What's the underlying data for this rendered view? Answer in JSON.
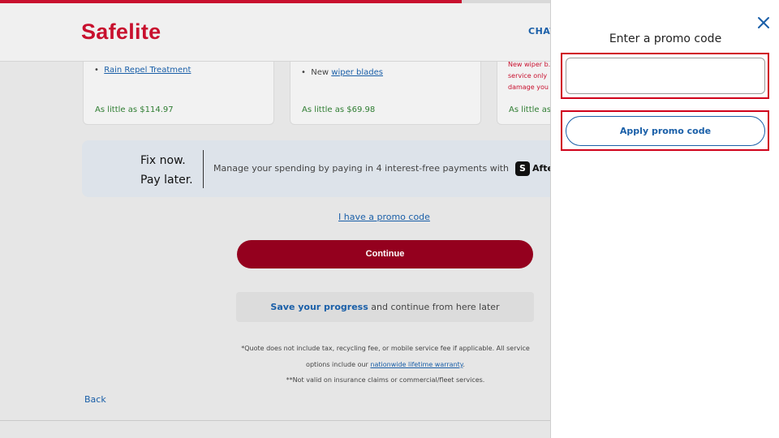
{
  "progress": {
    "fraction": 0.593
  },
  "header": {
    "logo": "Safelite",
    "chat_label": "CHAT"
  },
  "cards": [
    {
      "item_link": "Rain Repel Treatment",
      "price": "As little as $114.97"
    },
    {
      "item_prefix": "New",
      "item_link": "wiper blades",
      "price": "As little as $69.98"
    },
    {
      "warning": "New wiper b... service only damage you",
      "price": "As little as"
    }
  ],
  "banner": {
    "title_line1": "Fix now.",
    "title_line2": "Pay later.",
    "text": "Manage your spending by paying in 4 interest-free payments with",
    "brand_badge": "S",
    "brand_word": "Afte"
  },
  "promo_link": "I have a promo code",
  "continue_label": "Continue",
  "save": {
    "link": "Save your progress",
    "rest": " and continue from here later"
  },
  "footnotes": {
    "line1": "*Quote does not include tax, recycling fee, or mobile service fee if applicable. All service options include our ",
    "line1_link": "nationwide lifetime warranty",
    "line1_end": ".",
    "line2": "**Not valid on insurance claims or commercial/fleet services."
  },
  "back_label": "Back",
  "drawer": {
    "title": "Enter a promo code",
    "input_value": "",
    "input_placeholder": "",
    "apply_label": "Apply promo code",
    "close_icon": "close-icon"
  },
  "colors": {
    "brand_red": "#c8102e",
    "continue_red": "#94001e",
    "link_blue": "#1a5fa8",
    "price_green": "#2f7d32",
    "highlight_red": "#d0021b"
  }
}
